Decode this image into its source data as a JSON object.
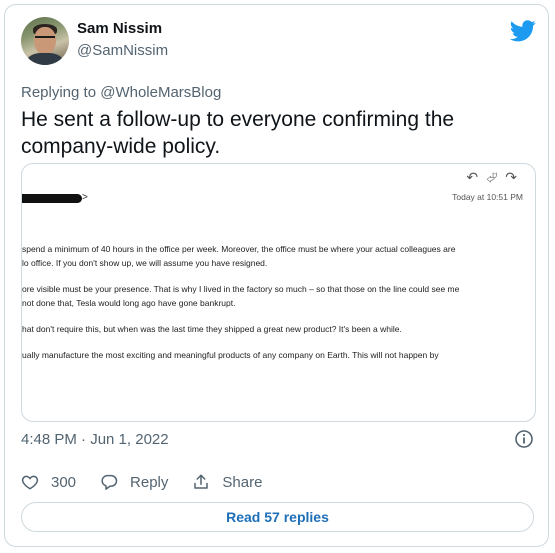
{
  "author": {
    "display_name": "Sam Nissim",
    "handle": "@SamNissim"
  },
  "reply_context": {
    "prefix": "Replying to",
    "target": "@WholeMarsBlog"
  },
  "tweet": {
    "text": "He sent a follow-up to everyone confirming the company-wide policy."
  },
  "email_image": {
    "time": "Today at 10:51 PM",
    "lines": [
      "spend a minimum of 40 hours in the office per week. Moreover, the office must be where your actual colleagues are",
      "lo office. If you don't show up, we will assume you have resigned.",
      "ore visible must be your presence. That is why I lived in the factory so much – so that those on the line could see me",
      " not done that, Tesla would long ago have gone bankrupt.",
      "hat don't require this, but when was the last time they shipped a great new product? It's been a while.",
      "ually manufacture the most exciting and meaningful products of any company on Earth. This will not happen by"
    ]
  },
  "meta": {
    "timestamp": "4:48 PM · Jun 1, 2022"
  },
  "actions": {
    "like_count": "300",
    "reply_label": "Reply",
    "share_label": "Share"
  },
  "read_replies_label": "Read 57 replies",
  "colors": {
    "twitter_blue": "#1d9bf0",
    "link_blue": "#1d6fb8",
    "secondary_text": "#536471",
    "border": "#cfd9de"
  },
  "icons": [
    "twitter-bird-icon",
    "info-icon",
    "heart-icon",
    "reply-bubble-icon",
    "share-icon",
    "reply-arrow-icon",
    "reply-all-icon",
    "forward-icon"
  ]
}
